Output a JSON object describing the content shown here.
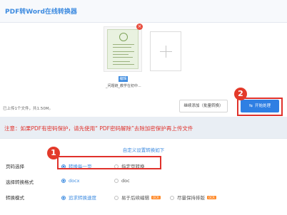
{
  "app": {
    "title": "PDF转Word在线转换器"
  },
  "upload": {
    "file": {
      "name": "_问题链_教学在初中...",
      "edit_label": "编辑",
      "remove_glyph": "×"
    },
    "summary": "已上传1个文件，共1.50M。",
    "continue_label": "继续添加（批量转换）",
    "start_label": "开始处理",
    "start_icon": "⇆"
  },
  "annotations": {
    "badge_1": "1",
    "badge_2": "2",
    "color": "#e0312b"
  },
  "notice": "注意：如果PDF有密码保护，请先使用“ PDF密码解除”去除加密保护再上传文件",
  "settings": {
    "toggle_label": "自定义设置转换如下",
    "page_select": {
      "label": "页码选择",
      "options": [
        {
          "label": "转换每一页",
          "selected": true
        },
        {
          "label": "指定页转换",
          "selected": false
        }
      ]
    },
    "format": {
      "label": "选择转换格式",
      "options": [
        {
          "label": "docx",
          "selected": true
        },
        {
          "label": "doc",
          "selected": false
        }
      ]
    },
    "mode": {
      "label": "转换模式",
      "options": [
        {
          "label": "追求转换速度",
          "selected": true
        },
        {
          "label": "易于后续编辑",
          "selected": false,
          "badge": "OCR"
        },
        {
          "label": "尽量保持排版",
          "selected": false,
          "badge": "OCR"
        }
      ]
    }
  },
  "colors": {
    "accent": "#3d8be0",
    "primary_button": "#2f7fe3",
    "ocr_badge": "#ff8a2a"
  }
}
